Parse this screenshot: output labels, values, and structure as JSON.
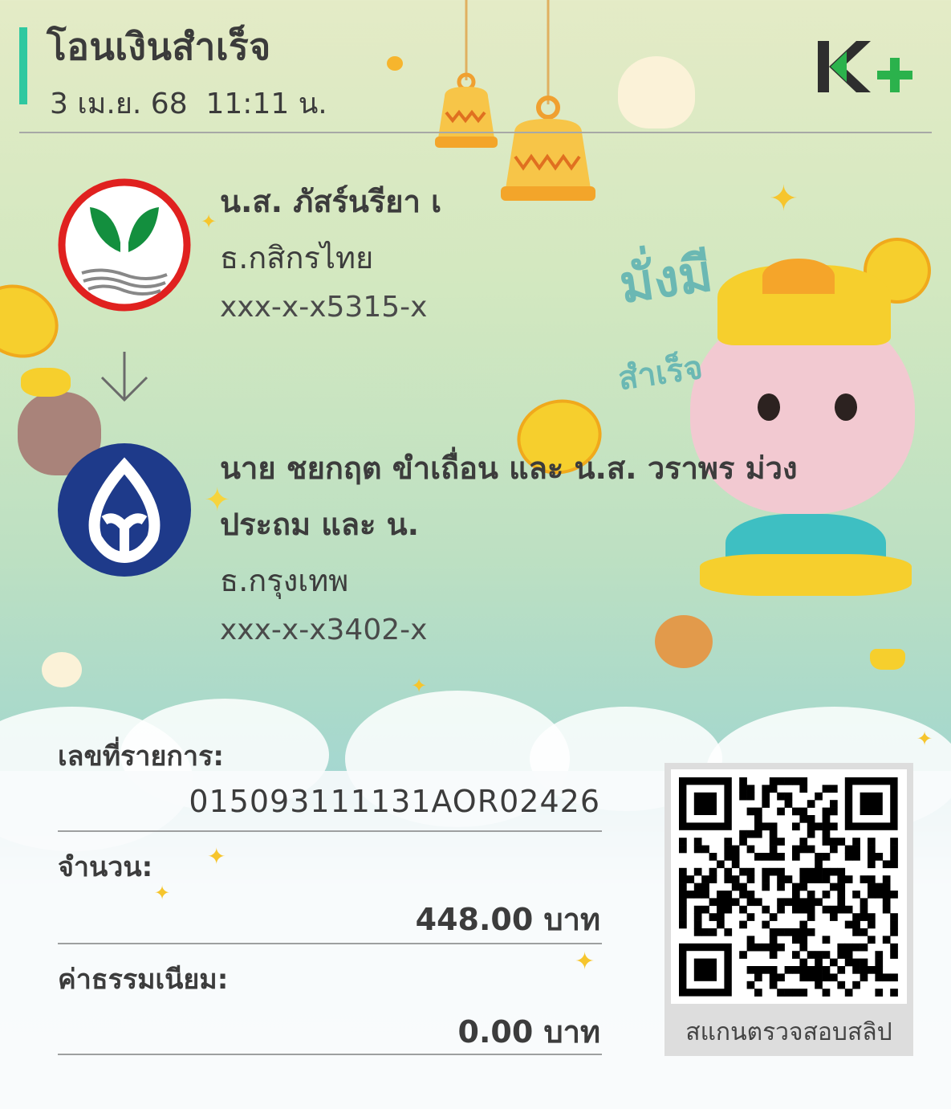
{
  "header": {
    "title": "โอนเงินสำเร็จ",
    "datetime": "3 เม.ย. 68  11:11 น.",
    "app_logo": "K+"
  },
  "sender": {
    "name": "น.ส. ภัสร์นรียา เ",
    "bank": "ธ.กสิกรไทย",
    "account": "xxx-x-x5315-x",
    "logo_icon": "kasikorn-bank-logo"
  },
  "receiver": {
    "name_line1": "นาย ชยกฤต ขำเถื่อน และ น.ส. วราพร ม่วง",
    "name_line2": "ประถม และ น.",
    "bank": "ธ.กรุงเทพ",
    "account": "xxx-x-x3402-x",
    "logo_icon": "bangkok-bank-logo"
  },
  "sticker_text": {
    "line1": "มั่งมี",
    "line2": "สำเร็จ"
  },
  "details": {
    "ref_label": "เลขที่รายการ:",
    "ref_value": "015093111131AOR02426",
    "amount_label": "จำนวน:",
    "amount_value": "448.00 บาท",
    "fee_label": "ค่าธรรมเนียม:",
    "fee_value": "0.00 บาท"
  },
  "qr": {
    "caption": "สแกนตรวจสอบสลิป"
  },
  "colors": {
    "accent": "#2fc8a0",
    "kbank_green": "#138f3e",
    "kbank_red": "#e0211f",
    "bbl_blue": "#1e3a8a",
    "kplus_green": "#2bb24c"
  }
}
